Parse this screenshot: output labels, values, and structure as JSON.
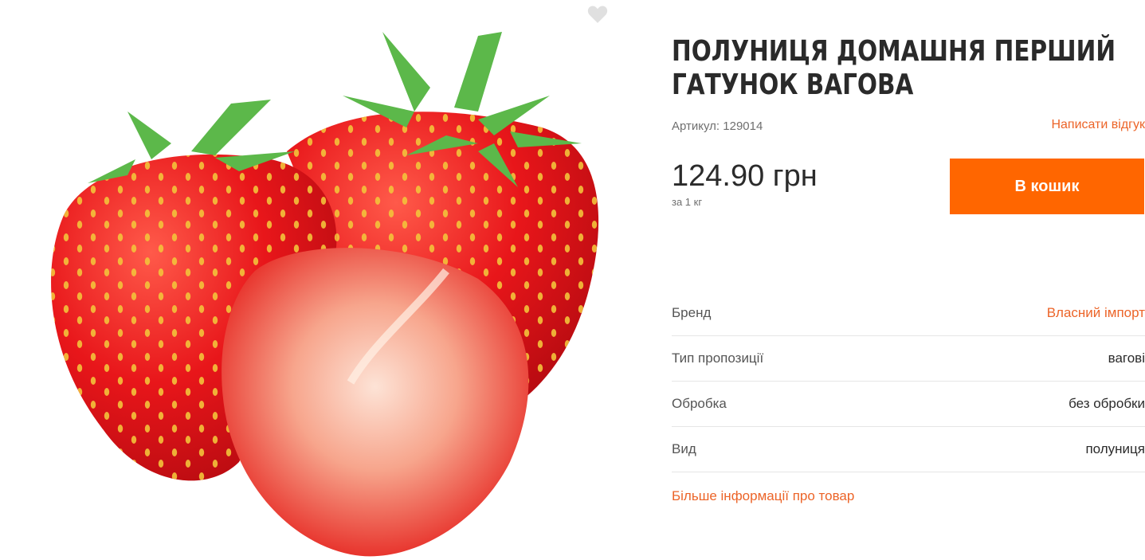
{
  "product": {
    "title": "ПОЛУНИЦЯ ДОМАШНЯ ПЕРШИЙ ГАТУНОК ВАГОВА",
    "sku": "Артикул: 129014",
    "review_link": "Написати відгук",
    "price": "124.90 грн",
    "unit": "за 1 кг",
    "cart_button": "В кошик",
    "image_icon": "strawberry-image",
    "favorite_icon": "heart-icon"
  },
  "specs": [
    {
      "label": "Бренд",
      "value": "Власний імпорт"
    },
    {
      "label": "Тип пропозиції",
      "value": "вагові"
    },
    {
      "label": "Обробка",
      "value": "без обробки"
    },
    {
      "label": "Вид",
      "value": "полуниця"
    }
  ],
  "more_info": "Більше інформації про товар",
  "colors": {
    "accent": "#ff6600",
    "link": "#ec6428",
    "divider": "#e6e6e6"
  }
}
